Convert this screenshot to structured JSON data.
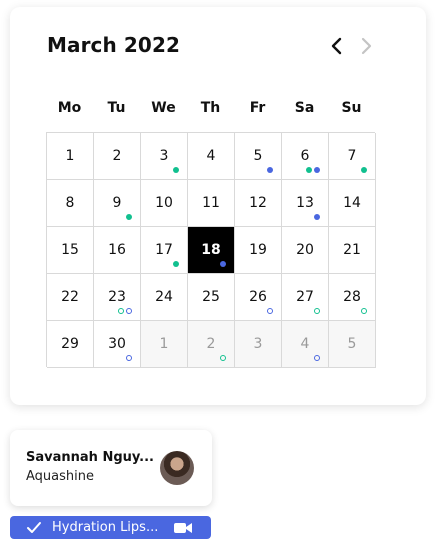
{
  "calendar": {
    "title": "March 2022",
    "weekdays": [
      "Mo",
      "Tu",
      "We",
      "Th",
      "Fr",
      "Sa",
      "Su"
    ],
    "weeks": [
      [
        {
          "d": "1",
          "dots": []
        },
        {
          "d": "2",
          "dots": []
        },
        {
          "d": "3",
          "dots": [
            "green"
          ]
        },
        {
          "d": "4",
          "dots": []
        },
        {
          "d": "5",
          "dots": [
            "blue"
          ]
        },
        {
          "d": "6",
          "dots": [
            "green",
            "blue"
          ]
        },
        {
          "d": "7",
          "dots": [
            "green"
          ]
        }
      ],
      [
        {
          "d": "8",
          "dots": []
        },
        {
          "d": "9",
          "dots": [
            "green"
          ]
        },
        {
          "d": "10",
          "dots": []
        },
        {
          "d": "11",
          "dots": []
        },
        {
          "d": "12",
          "dots": []
        },
        {
          "d": "13",
          "dots": [
            "blue"
          ]
        },
        {
          "d": "14",
          "dots": []
        }
      ],
      [
        {
          "d": "15",
          "dots": []
        },
        {
          "d": "16",
          "dots": []
        },
        {
          "d": "17",
          "dots": [
            "green"
          ]
        },
        {
          "d": "18",
          "dots": [
            "blue"
          ],
          "selected": true
        },
        {
          "d": "19",
          "dots": []
        },
        {
          "d": "20",
          "dots": []
        },
        {
          "d": "21",
          "dots": []
        }
      ],
      [
        {
          "d": "22",
          "dots": []
        },
        {
          "d": "23",
          "dots": [
            "green-o",
            "blue-o"
          ]
        },
        {
          "d": "24",
          "dots": []
        },
        {
          "d": "25",
          "dots": []
        },
        {
          "d": "26",
          "dots": [
            "blue-o"
          ]
        },
        {
          "d": "27",
          "dots": [
            "green-o"
          ]
        },
        {
          "d": "28",
          "dots": [
            "green-o"
          ]
        }
      ],
      [
        {
          "d": "29",
          "dots": []
        },
        {
          "d": "30",
          "dots": [
            "blue-o"
          ]
        },
        {
          "d": "1",
          "dots": [],
          "other": true
        },
        {
          "d": "2",
          "dots": [
            "green-o"
          ],
          "other": true
        },
        {
          "d": "3",
          "dots": [],
          "other": true
        },
        {
          "d": "4",
          "dots": [
            "blue-o"
          ],
          "other": true
        },
        {
          "d": "5",
          "dots": [],
          "other": true
        }
      ]
    ]
  },
  "colors": {
    "green": "#11c08f",
    "blue": "#4a67e0",
    "selected": "#000000"
  },
  "contact": {
    "name": "Savannah Nguy...",
    "company": "Aquashine"
  },
  "event": {
    "title": "Hydration Lips...",
    "icons": [
      "check-icon",
      "video-camera-icon"
    ]
  }
}
